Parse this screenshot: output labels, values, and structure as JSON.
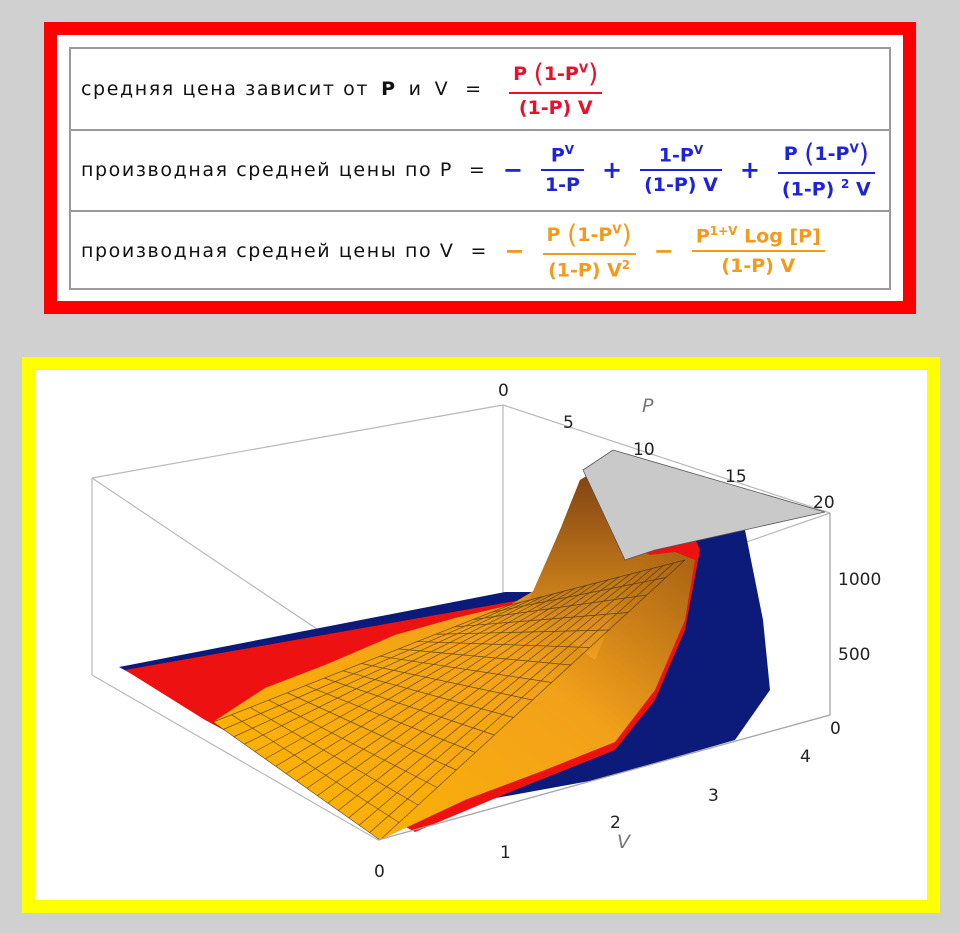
{
  "formulas": {
    "avg_price": {
      "label": "средняя цена зависит от",
      "var1": "P",
      "conj": "и",
      "var2": "V",
      "eq": "=",
      "term": {
        "num_a": "P",
        "num_b": "1-P",
        "num_exp": "V",
        "den": "(1-P) V"
      }
    },
    "deriv_p": {
      "label": "производная средней цены по P",
      "eq": "=",
      "minus": "−",
      "plus1": "+",
      "plus2": "+",
      "t1": {
        "num_base": "P",
        "num_exp": "V",
        "den": "1-P"
      },
      "t2": {
        "num_base": "1-P",
        "num_exp": "V",
        "den": "(1-P) V"
      },
      "t3": {
        "num_a": "P",
        "num_b": "1-P",
        "num_exp": "V",
        "den_a": "(1-P)",
        "den_exp": "2",
        "den_b": "V"
      }
    },
    "deriv_v": {
      "label": "производная средней цены по V",
      "eq": "=",
      "minus1": "−",
      "minus2": "−",
      "t1": {
        "num_a": "P",
        "num_b": "1-P",
        "num_exp": "V",
        "den_a": "(1-P) V",
        "den_exp": "2"
      },
      "t2": {
        "num_base": "P",
        "num_exp": "1+V",
        "num_tail": "Log [P]",
        "den": "(1-P) V"
      }
    }
  },
  "plot": {
    "p_axis": {
      "name": "P",
      "ticks": [
        "0",
        "5",
        "10",
        "15",
        "20"
      ]
    },
    "v_axis": {
      "name": "V",
      "ticks": [
        "0",
        "1",
        "2",
        "3",
        "4"
      ]
    },
    "z_axis": {
      "ticks": [
        "0",
        "500",
        "1000"
      ]
    },
    "colors": {
      "orange": "#f6a91a",
      "red": "#ee1111",
      "navy": "#0c1a7a",
      "cap": "#c9c9c9"
    }
  }
}
